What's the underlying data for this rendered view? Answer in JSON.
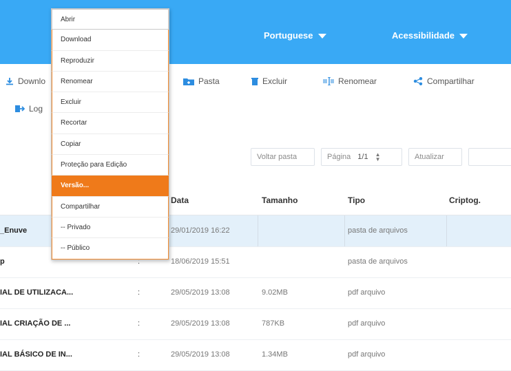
{
  "header": {
    "language_label": "Portuguese",
    "accessibility_label": "Acessibilidade"
  },
  "toolbar": {
    "download_label": "Downlo",
    "folder_label": "Pasta",
    "delete_label": "Excluir",
    "rename_label": "Renomear",
    "share_label": "Compartilhar",
    "logout_label": "Log"
  },
  "controls": {
    "back_label": "Voltar pasta",
    "page_label": "Página",
    "page_value": "1/1",
    "refresh_label": "Atualizar"
  },
  "table": {
    "columns": [
      "Data",
      "Tamanho",
      "Tipo",
      "Criptog."
    ],
    "rows": [
      {
        "name": "_Enuve",
        "dots": "",
        "date": "29/01/2019 16:22",
        "size": "",
        "type": "pasta de arquivos"
      },
      {
        "name": "p",
        "dots": ":",
        "date": "18/06/2019 15:51",
        "size": "",
        "type": "pasta de arquivos"
      },
      {
        "name": "IAL DE UTILIZACA...",
        "dots": ":",
        "date": "29/05/2019 13:08",
        "size": "9.02MB",
        "type": "pdf arquivo"
      },
      {
        "name": "IAL CRIAÇÃO DE ...",
        "dots": ":",
        "date": "29/05/2019 13:08",
        "size": "787KB",
        "type": "pdf arquivo"
      },
      {
        "name": "IAL BÁSICO DE IN...",
        "dots": ":",
        "date": "29/05/2019 13:08",
        "size": "1.34MB",
        "type": "pdf arquivo"
      }
    ]
  },
  "context_menu": {
    "items": [
      "Abrir",
      "Download",
      "Reproduzir",
      "Renomear",
      "Excluir",
      "Recortar",
      "Copiar",
      "Proteção para Edição",
      "Versão...",
      "Compartilhar",
      "-- Privado",
      "-- Público"
    ],
    "active_index": 8
  },
  "colors": {
    "header_bg": "#39a9f5",
    "accent_orange": "#ef7a1a",
    "selected_row": "#e3f0fa",
    "icon_blue": "#2d8de0"
  }
}
